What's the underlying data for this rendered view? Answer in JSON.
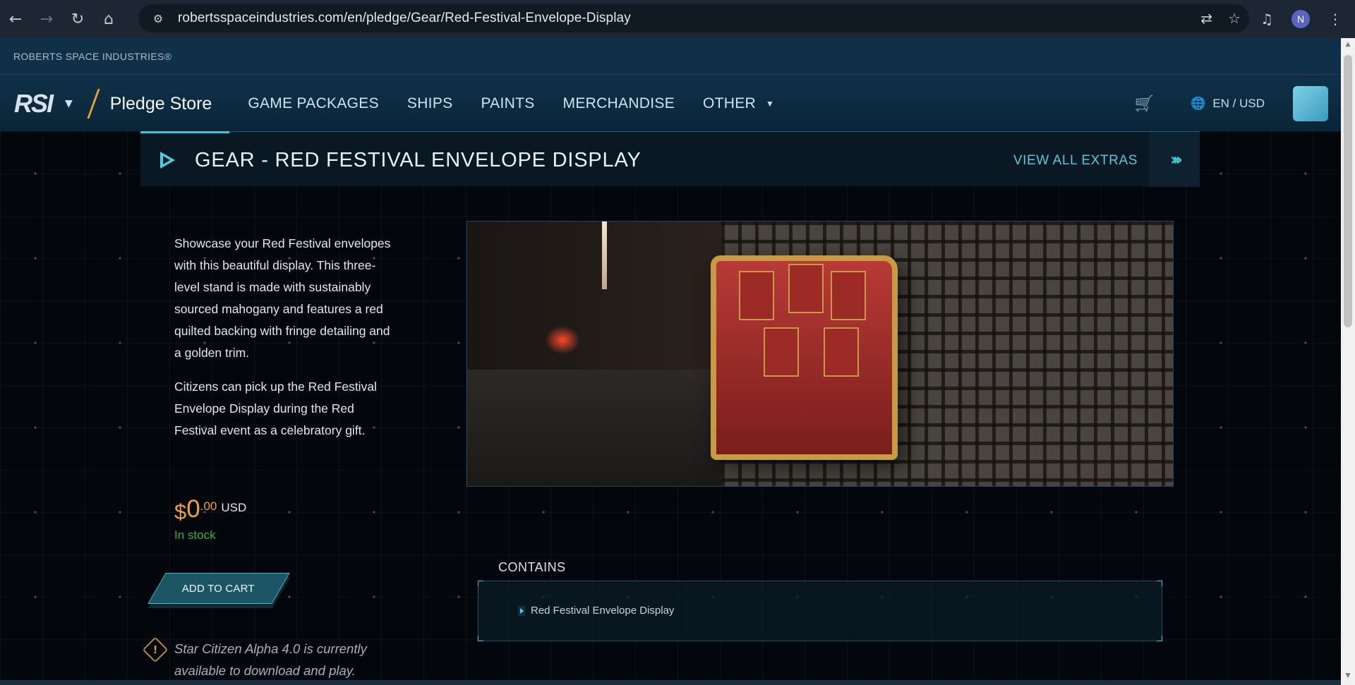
{
  "browser": {
    "url": "robertsspaceindustries.com/en/pledge/Gear/Red-Festival-Envelope-Display",
    "profile_initial": "N"
  },
  "topbar": {
    "brand": "ROBERTS SPACE INDUSTRIES®"
  },
  "nav": {
    "logo": "RSI",
    "store_title": "Pledge Store",
    "menu": [
      "GAME PACKAGES",
      "SHIPS",
      "PAINTS",
      "MERCHANDISE",
      "OTHER"
    ],
    "locale": "EN / USD"
  },
  "product": {
    "title": "GEAR - RED FESTIVAL ENVELOPE DISPLAY",
    "view_all": "VIEW ALL EXTRAS",
    "description": [
      "Showcase your Red Festival envelopes with this beautiful display. This three-level stand is made with sustainably sourced mahogany and features a red quilted backing with fringe detailing and a golden trim.",
      "Citizens can pick up the Red Festival Envelope Display during the Red Festival event as a celebratory gift."
    ],
    "price": {
      "currency_symbol": "$",
      "whole": "0",
      "cents": ".00",
      "unit": "USD"
    },
    "stock": "In stock",
    "add_to_cart": "ADD TO CART",
    "notice": "Star Citizen Alpha 4.0 is currently available to download and play.",
    "contains_label": "CONTAINS",
    "contains": [
      "Red Festival Envelope Display"
    ]
  },
  "colors": {
    "accent_cyan": "#43d2e4",
    "price_orange": "#f0a334",
    "stock_green": "#2fb04e",
    "nav_bg": "#0f3149"
  }
}
